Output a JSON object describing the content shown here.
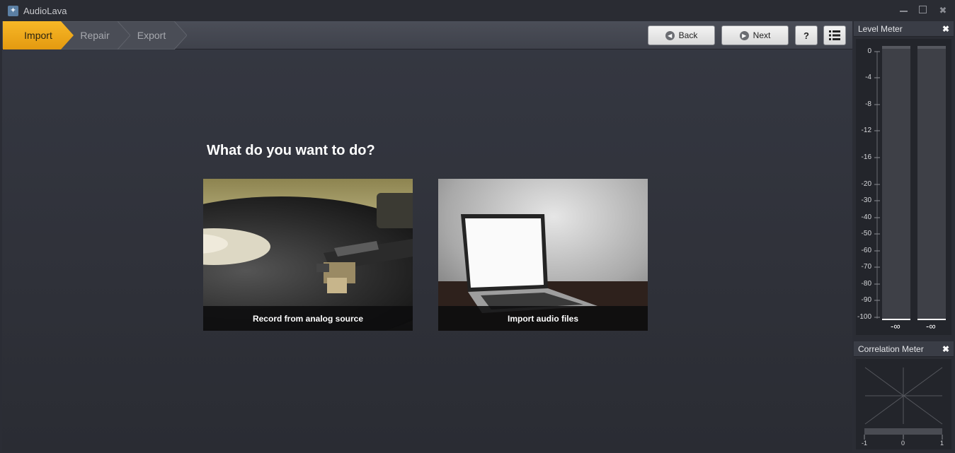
{
  "window": {
    "title": "AudioLava",
    "app_icon": "sparkle-icon",
    "controls": [
      "minimize-icon",
      "maximize-icon",
      "close-icon"
    ]
  },
  "breadcrumb": {
    "steps": [
      {
        "label": "Import",
        "active": true
      },
      {
        "label": "Repair",
        "active": false
      },
      {
        "label": "Export",
        "active": false
      }
    ],
    "active_color": "#f0a81c"
  },
  "toolbar": {
    "back_label": "Back",
    "next_label": "Next",
    "help_label": "?",
    "back_icon": "arrow-left-circle-icon",
    "next_icon": "arrow-right-circle-icon",
    "list_icon": "list-icon"
  },
  "main": {
    "heading": "What do you want to do?",
    "options": [
      {
        "caption": "Record from analog source",
        "image": "turntable-photo"
      },
      {
        "caption": "Import audio files",
        "image": "laptop-photo"
      }
    ]
  },
  "level_meter": {
    "title": "Level Meter",
    "scale": [
      "0",
      "-4",
      "-8",
      "-12",
      "-16",
      "-20",
      "-30",
      "-40",
      "-50",
      "-60",
      "-70",
      "-80",
      "-90",
      "-100"
    ],
    "left_value": "-∞",
    "right_value": "-∞"
  },
  "correlation_meter": {
    "title": "Correlation Meter",
    "scale": [
      "-1",
      "0",
      "1"
    ]
  }
}
